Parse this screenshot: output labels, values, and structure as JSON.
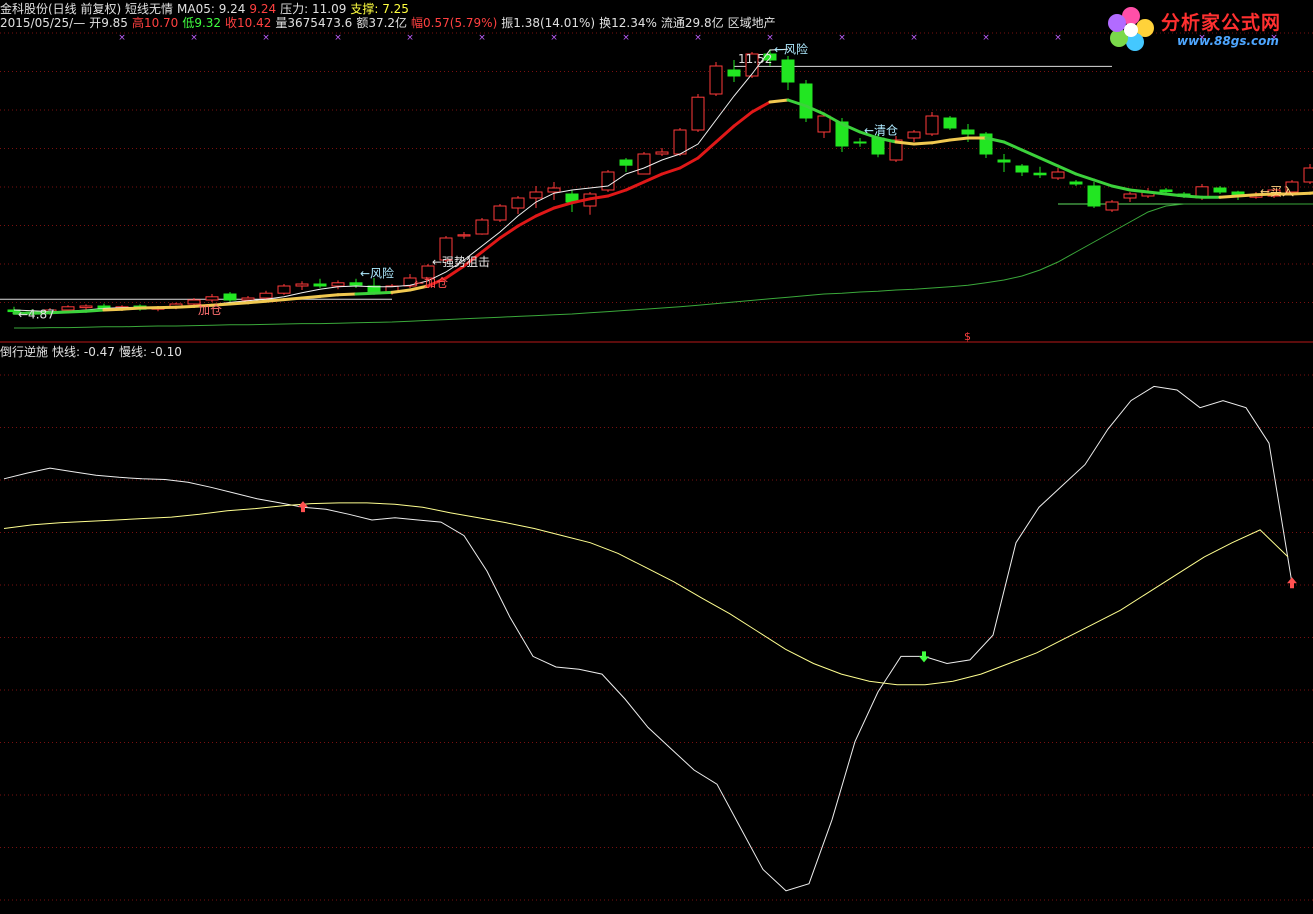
{
  "header": {
    "line1": [
      {
        "text": "金科股份(日线 前复权) 短线无情",
        "color": "#e0e0e0"
      },
      {
        "text": "MA05: 9.24",
        "color": "#e0e0e0"
      },
      {
        "text": "9.24",
        "color": "#ff4040"
      },
      {
        "text": "压力: 11.09",
        "color": "#e0e0e0"
      },
      {
        "text": "支撑: 7.25",
        "color": "#ffff40"
      }
    ],
    "line2": [
      {
        "text": "2015/05/25/—",
        "color": "#e0e0e0"
      },
      {
        "text": "开9.85",
        "color": "#e0e0e0"
      },
      {
        "text": "高10.70",
        "color": "#ff4040"
      },
      {
        "text": "低9.32",
        "color": "#40ff40"
      },
      {
        "text": "收10.42",
        "color": "#ff4040"
      },
      {
        "text": "量3675473.6",
        "color": "#e0e0e0"
      },
      {
        "text": "额37.2亿",
        "color": "#e0e0e0"
      },
      {
        "text": "幅0.57(5.79%)",
        "color": "#ff4040"
      },
      {
        "text": "振1.38(14.01%)",
        "color": "#e0e0e0"
      },
      {
        "text": "换12.34%",
        "color": "#e0e0e0"
      },
      {
        "text": "流通29.8亿",
        "color": "#e0e0e0"
      },
      {
        "text": "区域地产",
        "color": "#e0e0e0"
      }
    ],
    "sub": [
      {
        "text": "倒行逆施",
        "color": "#e0e0e0"
      },
      {
        "text": "快线: -0.47",
        "color": "#e0e0e0"
      },
      {
        "text": "慢线: -0.10",
        "color": "#e0e0e0"
      }
    ]
  },
  "logo": {
    "brand": "分析家公式网",
    "url": "www.88gs.com"
  },
  "colors": {
    "up": "#ff3a3a",
    "down": "#22e622",
    "grid": "#7a1010",
    "bg": "#000000"
  },
  "chart_data": [
    {
      "type": "candlestick",
      "title": "金科股份(日线 前复权) 短线无情",
      "ylim": [
        4.3,
        12.0
      ],
      "candles": [
        {
          "o": 5.0,
          "h": 5.08,
          "l": 4.9,
          "c": 4.96
        },
        {
          "o": 4.95,
          "h": 5.02,
          "l": 4.87,
          "c": 4.92
        },
        {
          "o": 4.92,
          "h": 5.05,
          "l": 4.88,
          "c": 5.0
        },
        {
          "o": 5.0,
          "h": 5.12,
          "l": 4.95,
          "c": 5.08
        },
        {
          "o": 5.06,
          "h": 5.14,
          "l": 5.0,
          "c": 5.1
        },
        {
          "o": 5.1,
          "h": 5.16,
          "l": 5.02,
          "c": 5.05
        },
        {
          "o": 5.05,
          "h": 5.12,
          "l": 4.98,
          "c": 5.08
        },
        {
          "o": 5.1,
          "h": 5.14,
          "l": 4.98,
          "c": 5.02
        },
        {
          "o": 5.02,
          "h": 5.1,
          "l": 4.97,
          "c": 5.06
        },
        {
          "o": 5.06,
          "h": 5.18,
          "l": 5.02,
          "c": 5.15
        },
        {
          "o": 5.15,
          "h": 5.3,
          "l": 5.1,
          "c": 5.25
        },
        {
          "o": 5.25,
          "h": 5.4,
          "l": 5.2,
          "c": 5.33
        },
        {
          "o": 5.4,
          "h": 5.45,
          "l": 5.2,
          "c": 5.25
        },
        {
          "o": 5.25,
          "h": 5.35,
          "l": 5.18,
          "c": 5.3
        },
        {
          "o": 5.3,
          "h": 5.48,
          "l": 5.25,
          "c": 5.42
        },
        {
          "o": 5.42,
          "h": 5.65,
          "l": 5.38,
          "c": 5.6
        },
        {
          "o": 5.6,
          "h": 5.72,
          "l": 5.5,
          "c": 5.65
        },
        {
          "o": 5.65,
          "h": 5.78,
          "l": 5.55,
          "c": 5.6
        },
        {
          "o": 5.6,
          "h": 5.74,
          "l": 5.52,
          "c": 5.68
        },
        {
          "o": 5.68,
          "h": 5.78,
          "l": 5.55,
          "c": 5.62
        },
        {
          "o": 5.6,
          "h": 5.8,
          "l": 5.4,
          "c": 5.45
        },
        {
          "o": 5.45,
          "h": 5.65,
          "l": 5.38,
          "c": 5.6
        },
        {
          "o": 5.6,
          "h": 5.9,
          "l": 5.55,
          "c": 5.8
        },
        {
          "o": 5.8,
          "h": 6.15,
          "l": 5.75,
          "c": 6.1
        },
        {
          "o": 6.25,
          "h": 6.85,
          "l": 6.2,
          "c": 6.8
        },
        {
          "o": 6.85,
          "h": 6.95,
          "l": 6.78,
          "c": 6.88
        },
        {
          "o": 6.9,
          "h": 7.3,
          "l": 6.88,
          "c": 7.25
        },
        {
          "o": 7.25,
          "h": 7.65,
          "l": 7.2,
          "c": 7.6
        },
        {
          "o": 7.55,
          "h": 7.85,
          "l": 7.4,
          "c": 7.8
        },
        {
          "o": 7.8,
          "h": 8.1,
          "l": 7.55,
          "c": 7.95
        },
        {
          "o": 7.95,
          "h": 8.2,
          "l": 7.75,
          "c": 8.05
        },
        {
          "o": 7.9,
          "h": 8.0,
          "l": 7.45,
          "c": 7.7
        },
        {
          "o": 7.6,
          "h": 7.95,
          "l": 7.38,
          "c": 7.9
        },
        {
          "o": 8.0,
          "h": 8.5,
          "l": 7.95,
          "c": 8.45
        },
        {
          "o": 8.75,
          "h": 8.8,
          "l": 8.45,
          "c": 8.62
        },
        {
          "o": 8.4,
          "h": 8.95,
          "l": 8.4,
          "c": 8.9
        },
        {
          "o": 8.9,
          "h": 9.05,
          "l": 8.85,
          "c": 8.95
        },
        {
          "o": 8.9,
          "h": 9.55,
          "l": 8.85,
          "c": 9.5
        },
        {
          "o": 9.5,
          "h": 10.4,
          "l": 9.45,
          "c": 10.32
        },
        {
          "o": 10.4,
          "h": 11.2,
          "l": 10.35,
          "c": 11.1
        },
        {
          "o": 11.0,
          "h": 11.25,
          "l": 10.7,
          "c": 10.85
        },
        {
          "o": 10.85,
          "h": 11.45,
          "l": 10.8,
          "c": 11.4
        },
        {
          "o": 11.4,
          "h": 11.52,
          "l": 11.1,
          "c": 11.25
        },
        {
          "o": 11.25,
          "h": 11.35,
          "l": 10.5,
          "c": 10.7
        },
        {
          "o": 10.65,
          "h": 10.75,
          "l": 9.7,
          "c": 9.8
        },
        {
          "o": 9.45,
          "h": 9.9,
          "l": 9.3,
          "c": 9.85
        },
        {
          "o": 9.7,
          "h": 9.8,
          "l": 8.95,
          "c": 9.1
        },
        {
          "o": 9.2,
          "h": 9.3,
          "l": 9.08,
          "c": 9.18
        },
        {
          "o": 9.3,
          "h": 9.4,
          "l": 8.82,
          "c": 8.9
        },
        {
          "o": 8.75,
          "h": 9.35,
          "l": 8.7,
          "c": 9.25
        },
        {
          "o": 9.3,
          "h": 9.5,
          "l": 9.2,
          "c": 9.45
        },
        {
          "o": 9.4,
          "h": 9.95,
          "l": 9.35,
          "c": 9.85
        },
        {
          "o": 9.8,
          "h": 9.85,
          "l": 9.5,
          "c": 9.55
        },
        {
          "o": 9.5,
          "h": 9.65,
          "l": 9.2,
          "c": 9.4
        },
        {
          "o": 9.4,
          "h": 9.45,
          "l": 8.8,
          "c": 8.9
        },
        {
          "o": 8.75,
          "h": 8.9,
          "l": 8.45,
          "c": 8.7
        },
        {
          "o": 8.6,
          "h": 8.65,
          "l": 8.35,
          "c": 8.45
        },
        {
          "o": 8.42,
          "h": 8.58,
          "l": 8.3,
          "c": 8.38
        },
        {
          "o": 8.3,
          "h": 8.55,
          "l": 8.25,
          "c": 8.45
        },
        {
          "o": 8.2,
          "h": 8.25,
          "l": 8.1,
          "c": 8.15
        },
        {
          "o": 8.1,
          "h": 8.2,
          "l": 7.55,
          "c": 7.6
        },
        {
          "o": 7.5,
          "h": 7.75,
          "l": 7.45,
          "c": 7.7
        },
        {
          "o": 7.8,
          "h": 7.95,
          "l": 7.7,
          "c": 7.9
        },
        {
          "o": 7.85,
          "h": 8.05,
          "l": 7.8,
          "c": 7.95
        },
        {
          "o": 8.0,
          "h": 8.05,
          "l": 7.92,
          "c": 7.96
        },
        {
          "o": 7.9,
          "h": 7.95,
          "l": 7.8,
          "c": 7.84
        },
        {
          "o": 7.8,
          "h": 8.15,
          "l": 7.75,
          "c": 8.08
        },
        {
          "o": 8.05,
          "h": 8.1,
          "l": 7.9,
          "c": 7.95
        },
        {
          "o": 7.95,
          "h": 7.98,
          "l": 7.75,
          "c": 7.85
        },
        {
          "o": 7.82,
          "h": 7.95,
          "l": 7.78,
          "c": 7.88
        },
        {
          "o": 7.85,
          "h": 8.02,
          "l": 7.8,
          "c": 8.0
        },
        {
          "o": 7.95,
          "h": 8.25,
          "l": 7.9,
          "c": 8.2
        },
        {
          "o": 8.2,
          "h": 8.65,
          "l": 8.15,
          "c": 8.55
        },
        {
          "o": 8.5,
          "h": 8.95,
          "l": 8.45,
          "c": 8.9
        },
        {
          "o": 8.9,
          "h": 9.55,
          "l": 8.85,
          "c": 9.5
        },
        {
          "o": 9.85,
          "h": 9.95,
          "l": 9.6,
          "c": 9.75
        },
        {
          "o": 9.85,
          "h": 10.7,
          "l": 9.32,
          "c": 10.42
        }
      ],
      "short_line": [
        4.92,
        4.92,
        4.93,
        4.95,
        4.97,
        5.0,
        5.02,
        5.05,
        5.06,
        5.07,
        5.09,
        5.12,
        5.15,
        5.18,
        5.22,
        5.26,
        5.3,
        5.34,
        5.38,
        5.4,
        5.42,
        5.44,
        5.5,
        5.6,
        5.8,
        6.1,
        6.45,
        6.8,
        7.1,
        7.35,
        7.55,
        7.68,
        7.78,
        7.85,
        8.0,
        8.2,
        8.4,
        8.55,
        8.8,
        9.2,
        9.6,
        9.95,
        10.2,
        10.25,
        10.1,
        9.9,
        9.65,
        9.45,
        9.3,
        9.2,
        9.15,
        9.18,
        9.25,
        9.3,
        9.3,
        9.2,
        9.0,
        8.8,
        8.6,
        8.4,
        8.25,
        8.1,
        8.0,
        7.95,
        7.9,
        7.85,
        7.82,
        7.82,
        7.85,
        7.88,
        7.9,
        7.9,
        7.92,
        7.96,
        8.0,
        8.1,
        8.3,
        8.55,
        8.85,
        9.24
      ],
      "short_line_colors": [
        "g",
        "g",
        "g",
        "g",
        "g",
        "g",
        "y",
        "y",
        "y",
        "y",
        "y",
        "y",
        "y",
        "y",
        "y",
        "y",
        "y",
        "y",
        "y",
        "y",
        "g",
        "g",
        "y",
        "y",
        "r",
        "r",
        "r",
        "r",
        "r",
        "r",
        "r",
        "r",
        "r",
        "r",
        "r",
        "r",
        "r",
        "r",
        "r",
        "r",
        "r",
        "r",
        "r",
        "y",
        "g",
        "g",
        "g",
        "g",
        "g",
        "g",
        "y",
        "y",
        "y",
        "y",
        "y",
        "g",
        "g",
        "g",
        "g",
        "g",
        "g",
        "g",
        "g",
        "g",
        "g",
        "g",
        "g",
        "g",
        "y",
        "y",
        "y",
        "y",
        "y",
        "y",
        "y",
        "r",
        "r",
        "r",
        "r",
        "r"
      ],
      "ma_white": [
        5.0,
        4.98,
        4.96,
        4.97,
        5.0,
        5.04,
        5.06,
        5.07,
        5.06,
        5.05,
        5.08,
        5.13,
        5.19,
        5.23,
        5.27,
        5.33,
        5.43,
        5.52,
        5.58,
        5.6,
        5.58,
        5.58,
        5.62,
        5.73,
        5.95,
        6.25,
        6.6,
        6.95,
        7.35,
        7.7,
        7.92,
        8.0,
        8.05,
        8.1,
        8.4,
        8.55,
        8.75,
        8.9,
        9.15,
        9.75,
        10.35,
        10.9,
        11.5,
        11.52
      ],
      "ma_green": [
        4.55,
        4.55,
        4.56,
        4.56,
        4.57,
        4.58,
        4.58,
        4.59,
        4.6,
        4.6,
        4.61,
        4.62,
        4.63,
        4.63,
        4.64,
        4.65,
        4.66,
        4.66,
        4.67,
        4.68,
        4.69,
        4.7,
        4.72,
        4.74,
        4.76,
        4.78,
        4.8,
        4.82,
        4.84,
        4.86,
        4.88,
        4.9,
        4.93,
        4.96,
        4.99,
        5.02,
        5.05,
        5.08,
        5.12,
        5.16,
        5.2,
        5.24,
        5.28,
        5.32,
        5.36,
        5.4,
        5.42,
        5.45,
        5.47,
        5.5,
        5.52,
        5.55,
        5.58,
        5.62,
        5.68,
        5.75,
        5.85,
        6.0,
        6.2,
        6.45,
        6.7,
        6.95,
        7.2,
        7.45,
        7.6,
        7.65,
        7.65,
        7.65,
        7.65,
        7.65,
        7.65,
        7.65,
        7.65,
        7.65,
        7.65,
        7.65,
        7.65,
        7.65,
        7.65,
        7.65
      ],
      "pressure": 11.09,
      "support": 7.25,
      "marks": [
        {
          "i": 0,
          "text": "←4.87",
          "color": "#e0e0e0",
          "dy": 8
        },
        {
          "i": 10,
          "text": "加仓",
          "color": "#ff7070",
          "dy": 12
        },
        {
          "i": 19,
          "text": "←风险",
          "color": "#aeeaff",
          "dy": -6
        },
        {
          "i": 22,
          "text": "←加仓",
          "color": "#ff5050",
          "dy": 6
        },
        {
          "i": 23,
          "text": "←强势狙击",
          "color": "#e8e8e8",
          "dy": -6
        },
        {
          "i": 40,
          "text": "11.52",
          "color": "#e0e0e0",
          "dy": -8
        },
        {
          "i": 42,
          "text": "←风险",
          "color": "#aeeaff",
          "dy": -4
        },
        {
          "i": 47,
          "text": "←清仓",
          "color": "#aeeaff",
          "dy": -8
        },
        {
          "i": 69,
          "text": "←买入",
          "color": "#ffd080",
          "dy": 0
        }
      ]
    },
    {
      "type": "line",
      "title": "倒行逆施",
      "ylim": [
        -5.0,
        2.7
      ],
      "series": [
        {
          "name": "快线",
          "color": "#eeeeee",
          "values": [
            1.0,
            1.08,
            1.15,
            1.1,
            1.05,
            1.02,
            1.0,
            0.99,
            0.95,
            0.88,
            0.8,
            0.72,
            0.66,
            0.6,
            0.57,
            0.5,
            0.42,
            0.45,
            0.42,
            0.39,
            0.2,
            -0.3,
            -0.95,
            -1.5,
            -1.65,
            -1.68,
            -1.75,
            -2.1,
            -2.5,
            -2.8,
            -3.1,
            -3.3,
            -3.9,
            -4.5,
            -4.8,
            -4.7,
            -3.8,
            -2.7,
            -2.0,
            -1.5,
            -1.5,
            -1.6,
            -1.55,
            -1.2,
            0.1,
            0.6,
            0.9,
            1.2,
            1.7,
            2.1,
            2.3,
            2.25,
            2.0,
            2.1,
            2.0,
            1.5,
            -0.47
          ]
        },
        {
          "name": "慢线",
          "color": "#ffff90",
          "values": [
            0.3,
            0.35,
            0.38,
            0.4,
            0.42,
            0.44,
            0.46,
            0.5,
            0.55,
            0.58,
            0.62,
            0.65,
            0.66,
            0.66,
            0.64,
            0.6,
            0.52,
            0.45,
            0.38,
            0.3,
            0.2,
            0.1,
            -0.05,
            -0.25,
            -0.45,
            -0.68,
            -0.9,
            -1.15,
            -1.4,
            -1.6,
            -1.75,
            -1.85,
            -1.9,
            -1.9,
            -1.85,
            -1.75,
            -1.6,
            -1.45,
            -1.25,
            -1.05,
            -0.85,
            -0.6,
            -0.35,
            -0.1,
            0.1,
            0.28,
            -0.1
          ]
        }
      ],
      "signals": [
        {
          "series": "快线",
          "i": 13,
          "type": "up",
          "color": "#ff5050"
        },
        {
          "series": "快线",
          "i": 40,
          "type": "down",
          "color": "#40ff40"
        },
        {
          "series": "快线",
          "i": 56,
          "type": "up",
          "color": "#ff5050"
        }
      ]
    }
  ]
}
